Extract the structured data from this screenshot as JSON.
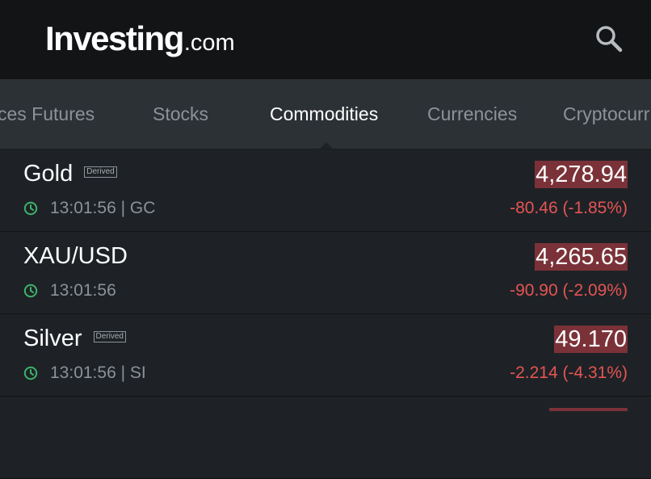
{
  "header": {
    "logo_main": "Investing",
    "logo_suffix": ".com",
    "search_icon": "search-icon"
  },
  "tabs": [
    {
      "label": "ces Futures",
      "active": false
    },
    {
      "label": "Stocks",
      "active": false
    },
    {
      "label": "Commodities",
      "active": true
    },
    {
      "label": "Currencies",
      "active": false
    },
    {
      "label": "Cryptocurr",
      "active": false
    }
  ],
  "instruments": [
    {
      "name": "Gold",
      "derived": "Derived",
      "time": "13:01:56",
      "symbol": "GC",
      "meta": "13:01:56 | GC",
      "price": "4,278.94",
      "change": "-80.46 (-1.85%)"
    },
    {
      "name": "XAU/USD",
      "derived": "",
      "time": "13:01:56",
      "symbol": "",
      "meta": "13:01:56",
      "price": "4,265.65",
      "change": "-90.90 (-2.09%)"
    },
    {
      "name": "Silver",
      "derived": "Derived",
      "time": "13:01:56",
      "symbol": "SI",
      "meta": "13:01:56 | SI",
      "price": "49.170",
      "change": "-2.214 (-4.31%)"
    }
  ],
  "colors": {
    "header_bg": "#121416",
    "tabs_bg": "#2c3136",
    "list_bg": "#1e2226",
    "price_down_bg": "#7a3238",
    "change_down": "#e55454",
    "clock_green": "#3db36b"
  }
}
